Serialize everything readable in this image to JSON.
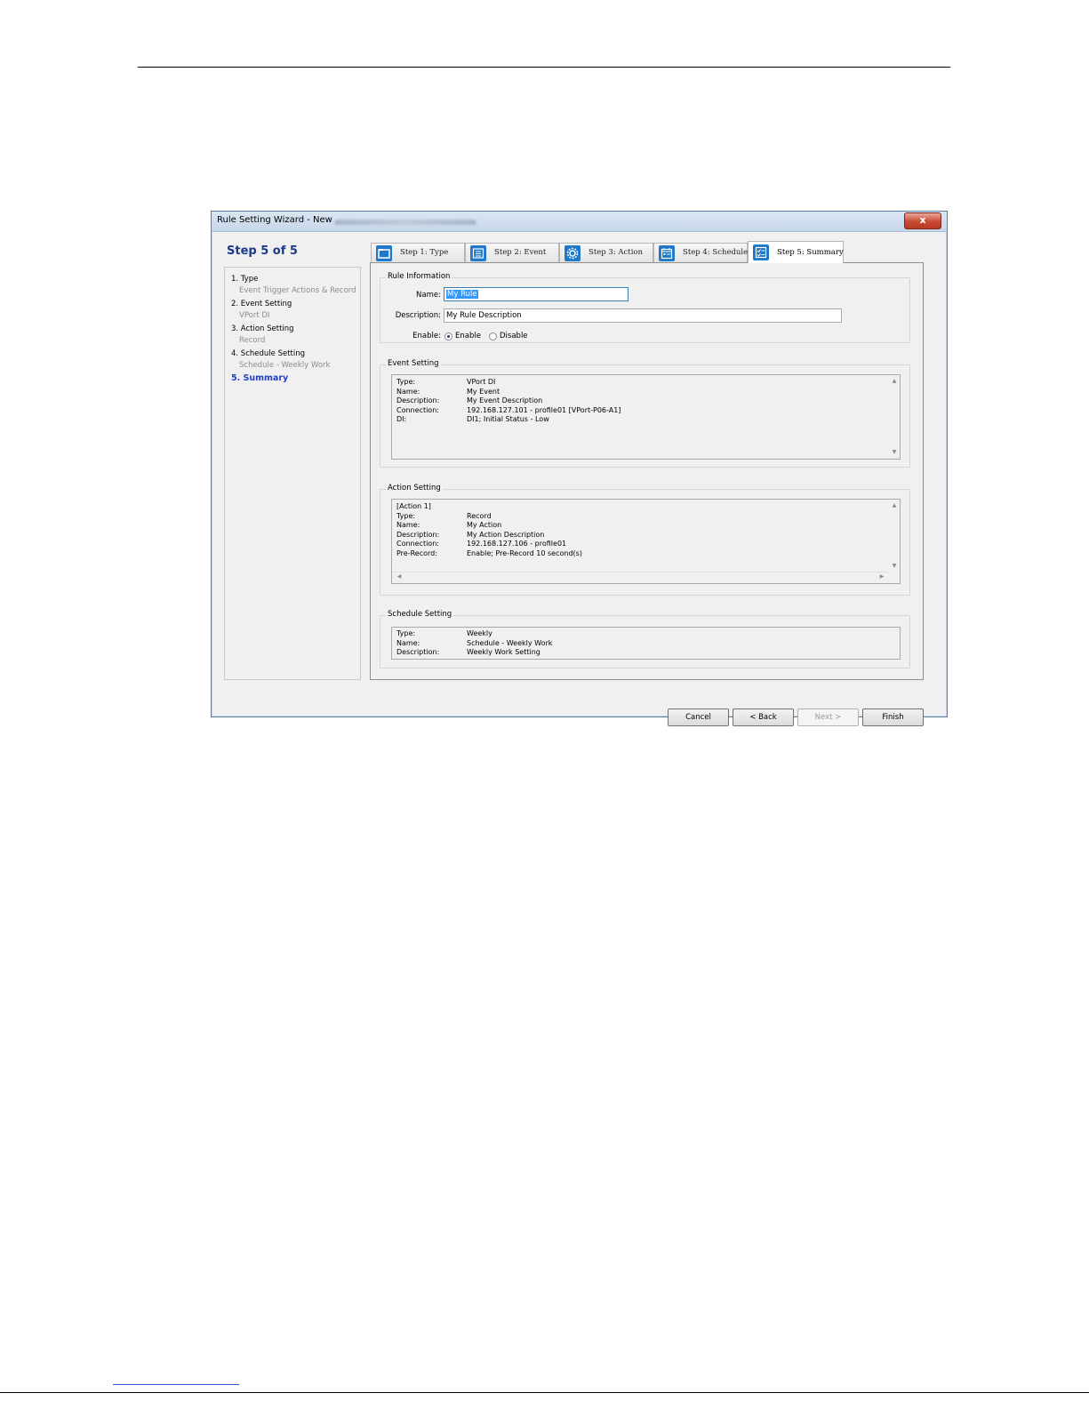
{
  "window": {
    "title": "Rule Setting Wizard - New",
    "close_glyph": "x"
  },
  "wizard": {
    "step_heading": "Step 5 of 5",
    "sidebar": [
      {
        "label": "1. Type",
        "sub": "Event Trigger Actions & Record"
      },
      {
        "label": "2. Event Setting",
        "sub": "VPort DI"
      },
      {
        "label": "3. Action Setting",
        "sub": "Record"
      },
      {
        "label": "4. Schedule Setting",
        "sub": "Schedule - Weekly Work"
      },
      {
        "label": "5. Summary",
        "sub": ""
      }
    ],
    "tabs": [
      {
        "label": "Step 1: Type",
        "icon": "folder-icon"
      },
      {
        "label": "Step 2: Event",
        "icon": "list-icon"
      },
      {
        "label": "Step 3: Action",
        "icon": "gear-icon"
      },
      {
        "label": "Step 4: Schedule",
        "icon": "calendar-icon"
      },
      {
        "label": "Step 5: Summary",
        "icon": "checklist-icon"
      }
    ]
  },
  "rule_info": {
    "title": "Rule Information",
    "name_label": "Name:",
    "name_value": "My Rule",
    "description_label": "Description:",
    "description_value": "My Rule Description",
    "enable_label": "Enable:",
    "enable_option": "Enable",
    "disable_option": "Disable",
    "selected": "Enable"
  },
  "event_setting": {
    "title": "Event Setting",
    "rows": [
      {
        "k": "Type:",
        "v": "VPort DI"
      },
      {
        "k": "Name:",
        "v": "My Event"
      },
      {
        "k": "Description:",
        "v": "My Event Description"
      },
      {
        "k": "Connection:",
        "v": "192.168.127.101 - profile01 [VPort-P06-A1]"
      },
      {
        "k": "DI:",
        "v": "DI1; Initial Status - Low"
      }
    ]
  },
  "action_setting": {
    "title": "Action Setting",
    "header": "[Action 1]",
    "rows": [
      {
        "k": "Type:",
        "v": "Record"
      },
      {
        "k": "Name:",
        "v": "My Action"
      },
      {
        "k": "Description:",
        "v": "My Action Description"
      },
      {
        "k": "Connection:",
        "v": "192.168.127.106 - profile01"
      },
      {
        "k": "Pre-Record:",
        "v": "Enable; Pre-Record 10 second(s)"
      }
    ]
  },
  "schedule_setting": {
    "title": "Schedule Setting",
    "rows": [
      {
        "k": "Type:",
        "v": "Weekly"
      },
      {
        "k": "Name:",
        "v": "Schedule - Weekly Work"
      },
      {
        "k": "Description:",
        "v": "Weekly Work Setting"
      }
    ]
  },
  "buttons": {
    "cancel": "Cancel",
    "back": "< Back",
    "next": "Next >",
    "finish": "Finish"
  }
}
